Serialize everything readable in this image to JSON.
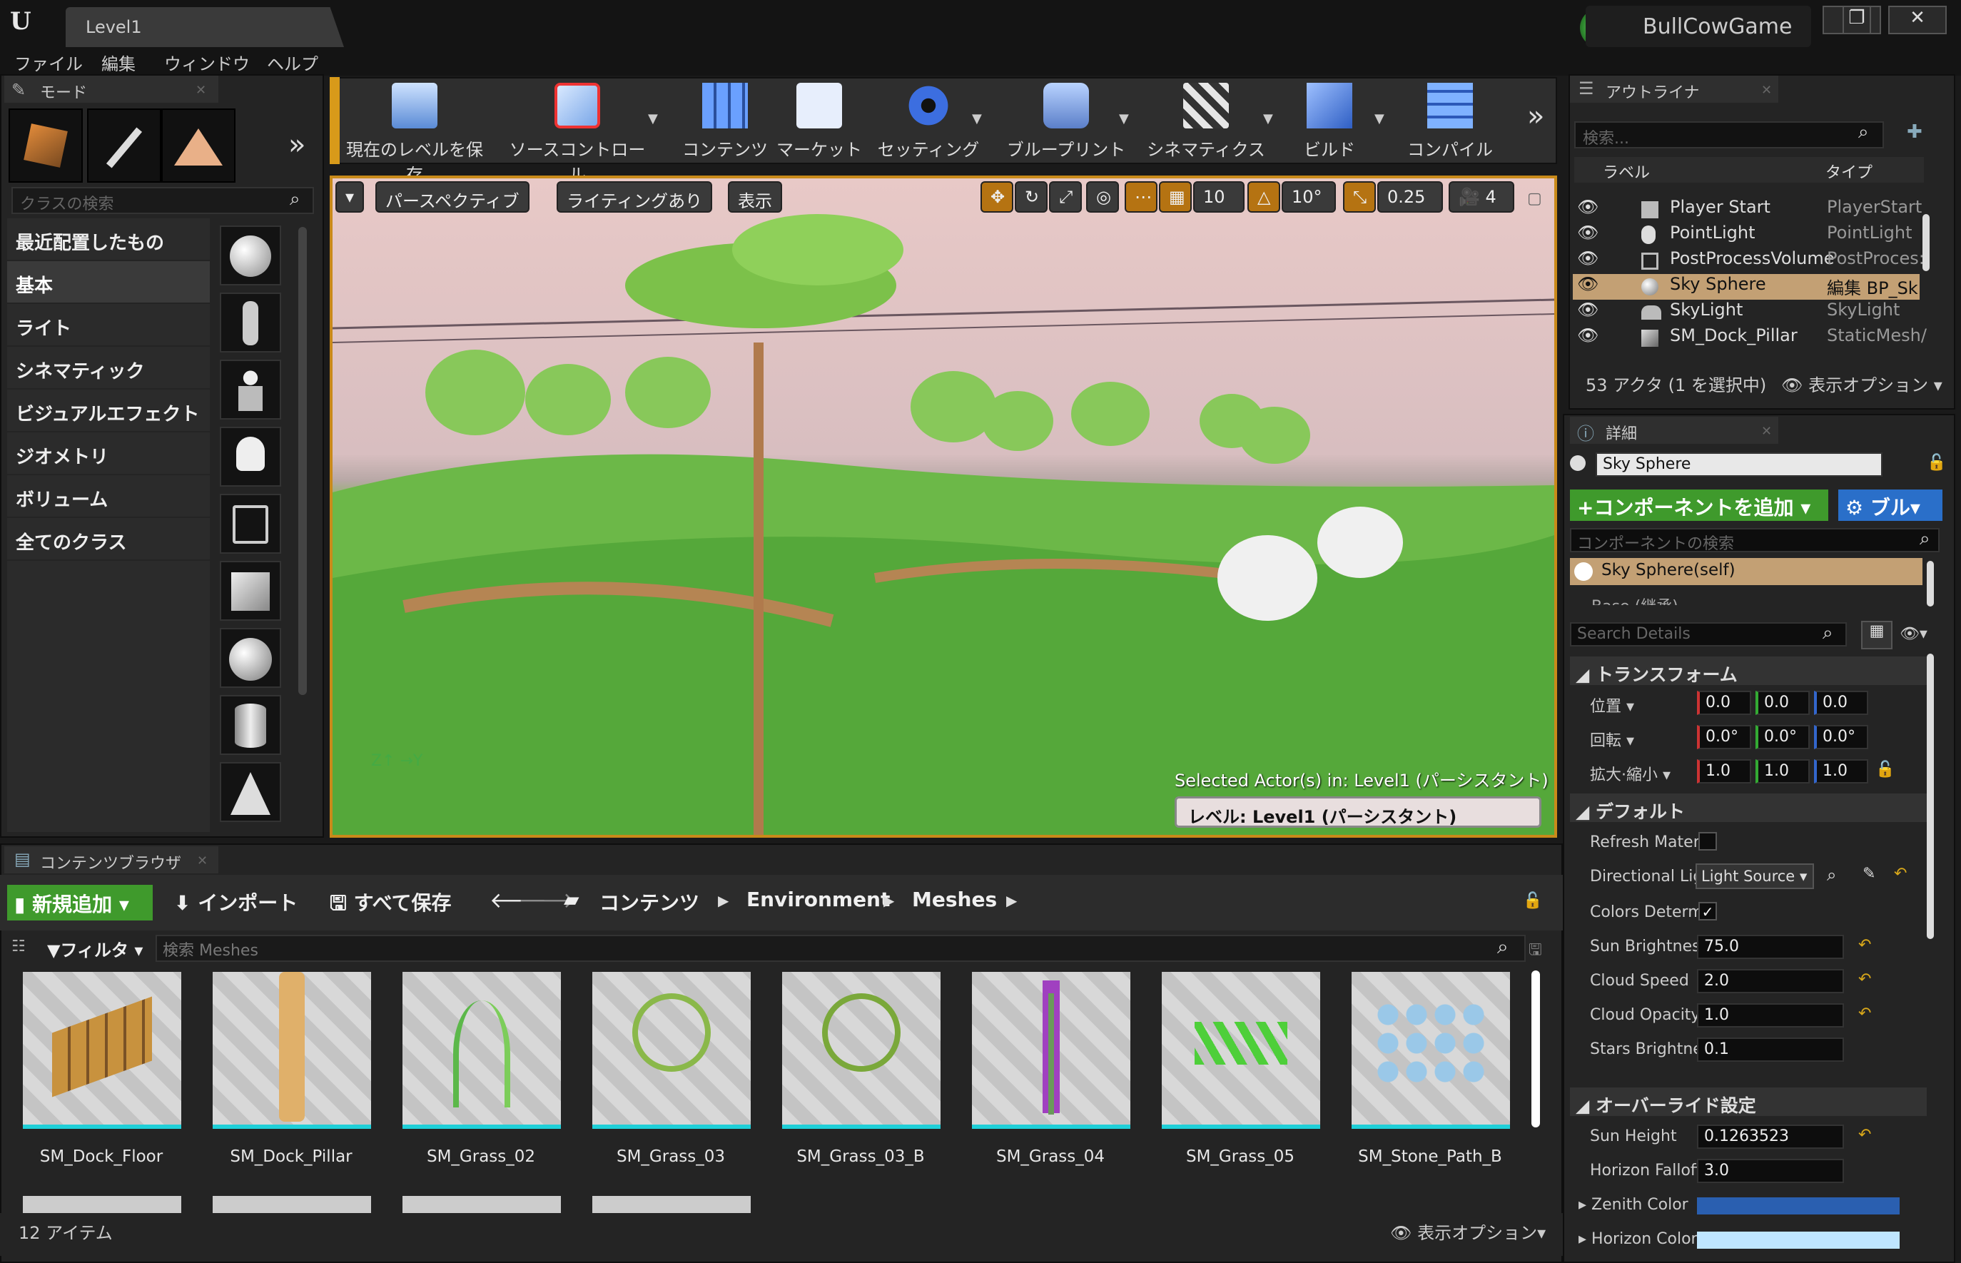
{
  "window": {
    "tab": "Level1",
    "project": "BullCowGame",
    "controls": [
      "—",
      "❐",
      "✕"
    ]
  },
  "menu": [
    "ファイル",
    "編集",
    "ウィンドウ",
    "ヘルプ"
  ],
  "modes": {
    "title": "モード",
    "search_placeholder": "クラスの検索",
    "categories": [
      "最近配置したもの",
      "基本",
      "ライト",
      "シネマティック",
      "ビジュアルエフェクト",
      "ジオメトリ",
      "ボリューム",
      "全てのクラス"
    ]
  },
  "toolbar": {
    "items": [
      "現在のレベルを保存",
      "ソースコントロール",
      "コンテンツ",
      "マーケット",
      "セッティング",
      "ブループリント",
      "シネマティクス",
      "ビルド",
      "コンパイル"
    ]
  },
  "viewport": {
    "perspective": "パースペクティブ",
    "lighting": "ライティングあり",
    "show": "表示",
    "grid_snap": "10",
    "rot_snap": "10°",
    "scale_snap": "0.25",
    "camera_speed": "4",
    "selected_info": "Selected Actor(s) in: Level1 (パーシスタント)",
    "level": "レベル: Level1 (パーシスタント)"
  },
  "outliner": {
    "title": "アウトライナ",
    "search_placeholder": "検索...",
    "col_label": "ラベル",
    "col_type": "タイプ",
    "rows": [
      {
        "label": "Player Start",
        "type": "PlayerStart",
        "icon": "player-start-icon"
      },
      {
        "label": "PointLight",
        "type": "PointLight",
        "icon": "point-light-icon"
      },
      {
        "label": "PostProcessVolume",
        "type": "PostProces:",
        "icon": "volume-icon"
      },
      {
        "label": "Sky Sphere",
        "type": "編集 BP_Sk",
        "icon": "sphere-icon"
      },
      {
        "label": "SkyLight",
        "type": "SkyLight",
        "icon": "skylight-icon"
      },
      {
        "label": "SM_Dock_Pillar",
        "type": "StaticMesh/",
        "icon": "mesh-icon"
      }
    ],
    "status": "53 アクタ (1 を選択中)",
    "view_options": "表示オプション"
  },
  "details": {
    "title": "詳細",
    "object_name": "Sky Sphere",
    "add_component": "+コンポーネントを追加",
    "blueprint": "ブル",
    "component_search_placeholder": "コンポーネントの検索",
    "component_self": "Sky Sphere(self)",
    "component_base": "Base (継承)",
    "search_placeholder": "Search Details",
    "transform": {
      "header": "トランスフォーム",
      "location_label": "位置",
      "rotation_label": "回転",
      "scale_label": "拡大·縮小",
      "location": [
        "0.0",
        "0.0",
        "0.0"
      ],
      "rotation": [
        "0.0°",
        "0.0°",
        "0.0°"
      ],
      "scale": [
        "1.0",
        "1.0",
        "1.0"
      ]
    },
    "default_header": "デフォルト",
    "props": [
      {
        "label": "Refresh Mater",
        "kind": "check",
        "value": ""
      },
      {
        "label": "Directional Lig",
        "kind": "dropdown",
        "value": "Light Source"
      },
      {
        "label": "Colors Determ",
        "kind": "check",
        "value": "✓"
      },
      {
        "label": "Sun Brightnes:",
        "kind": "number",
        "value": "75.0"
      },
      {
        "label": "Cloud Speed",
        "kind": "number",
        "value": "2.0"
      },
      {
        "label": "Cloud Opacity",
        "kind": "number",
        "value": "1.0"
      },
      {
        "label": "Stars Brightne",
        "kind": "number",
        "value": "0.1"
      }
    ],
    "override_header": "オーバーライド設定",
    "override_props": [
      {
        "label": "Sun Height",
        "value": "0.1263523"
      },
      {
        "label": "Horizon Falloff",
        "value": "3.0"
      }
    ],
    "color_props": [
      {
        "label": "Zenith Color",
        "color": "#2a5fb0"
      },
      {
        "label": "Horizon Color",
        "color": "#bfe6ff"
      }
    ]
  },
  "content_browser": {
    "title": "コンテンツブラウザ",
    "new": "新規追加",
    "import": "インポート",
    "save_all": "すべて保存",
    "breadcrumb": [
      "コンテンツ",
      "Environment",
      "Meshes"
    ],
    "filter": "フィルタ",
    "search_placeholder": "検索 Meshes",
    "assets": [
      "SM_Dock_Floor",
      "SM_Dock_Pillar",
      "SM_Grass_02",
      "SM_Grass_03",
      "SM_Grass_03_B",
      "SM_Grass_04",
      "SM_Grass_05",
      "SM_Stone_Path_B"
    ],
    "count": "12 アイテム",
    "view_options": "表示オプション"
  },
  "colors": {
    "accent_green": "#3f9a2c",
    "accent_blue": "#2a6fc9",
    "selection": "#c3a074",
    "viewport_border": "#c98a1a"
  }
}
